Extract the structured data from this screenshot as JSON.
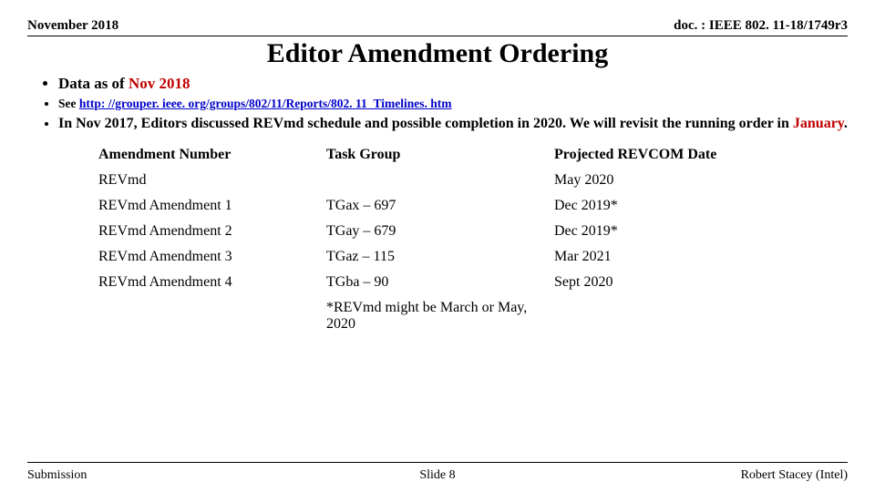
{
  "header": {
    "left": "November 2018",
    "right": "doc. : IEEE 802. 11-18/1749r3"
  },
  "title": "Editor Amendment Ordering",
  "bullets": {
    "b1_prefix": "Data as of ",
    "b1_redpart": "Nov 2018",
    "b2_prefix": "See ",
    "b2_link": "http: //grouper. ieee. org/groups/802/11/Reports/802. 11_Timelines. htm",
    "b3_part1": "In Nov 2017, Editors discussed REVmd schedule and possible completion in 2020. We will revisit the running order in ",
    "b3_red": "January",
    "b3_part2": "."
  },
  "table": {
    "headers": {
      "c1": "Amendment Number",
      "c2": "Task Group",
      "c3": "Projected REVCOM Date"
    },
    "rows": [
      {
        "c1": "REVmd",
        "c2": "",
        "c3": "May 2020"
      },
      {
        "c1": "REVmd Amendment 1",
        "c2": "TGax – 697",
        "c3": "Dec 2019*"
      },
      {
        "c1": "REVmd Amendment 2",
        "c2": "TGay – 679",
        "c3": "Dec 2019*"
      },
      {
        "c1": "REVmd Amendment 3",
        "c2": "TGaz – 115",
        "c3": "Mar 2021"
      },
      {
        "c1": "REVmd Amendment 4",
        "c2": "TGba – 90",
        "c3": "Sept 2020"
      }
    ],
    "footnote": "*REVmd might be March or May, 2020"
  },
  "footer": {
    "left": "Submission",
    "center": "Slide 8",
    "right": "Robert Stacey (Intel)"
  },
  "chart_data": {
    "type": "table",
    "title": "Editor Amendment Ordering",
    "columns": [
      "Amendment Number",
      "Task Group",
      "Projected REVCOM Date"
    ],
    "rows": [
      [
        "REVmd",
        "",
        "May 2020"
      ],
      [
        "REVmd Amendment 1",
        "TGax – 697",
        "Dec 2019*"
      ],
      [
        "REVmd Amendment 2",
        "TGay – 679",
        "Dec 2019*"
      ],
      [
        "REVmd Amendment 3",
        "TGaz – 115",
        "Mar 2021"
      ],
      [
        "REVmd Amendment 4",
        "TGba – 90",
        "Sept 2020"
      ]
    ],
    "footnote": "*REVmd might be March or May, 2020"
  }
}
